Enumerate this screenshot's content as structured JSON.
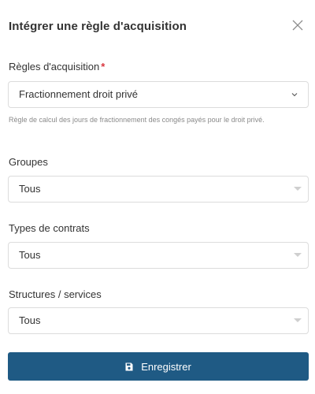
{
  "modal": {
    "title": "Intégrer une règle d'acquisition",
    "close_icon": "close-icon"
  },
  "acquisition_rules": {
    "label": "Règles d'acquisition",
    "required_mark": "*",
    "value": "Fractionnement droit privé",
    "help": "Règle de calcul des jours de fractionnement des congés payés pour le droit privé."
  },
  "groups": {
    "label": "Groupes",
    "value": "Tous"
  },
  "contract_types": {
    "label": "Types de contrats",
    "value": "Tous"
  },
  "structures": {
    "label": "Structures / services",
    "value": "Tous"
  },
  "save": {
    "label": "Enregistrer",
    "icon": "floppy-disk-icon"
  },
  "colors": {
    "primary": "#1f5a84",
    "required": "#d9363e",
    "border": "#dcdcdc"
  }
}
